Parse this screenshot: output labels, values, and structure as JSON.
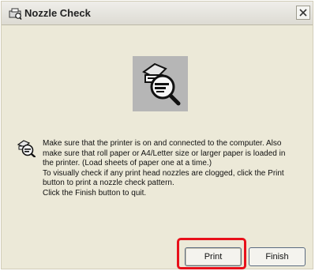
{
  "window": {
    "title": "Nozzle Check",
    "title_icon": "printer-check-icon",
    "close_icon": "close-icon"
  },
  "hero": {
    "icon": "nozzle-check-magnifier-icon"
  },
  "message": {
    "icon": "nozzle-check-icon",
    "lines": [
      "Make sure that the printer is on and connected to the computer. Also",
      "make sure that roll paper or A4/Letter size or larger paper is loaded in",
      "the printer. (Load sheets of paper one at a time.)",
      "To visually check if any print head nozzles are clogged, click the Print",
      "button to print a nozzle check pattern.",
      "Click the Finish button to quit."
    ]
  },
  "buttons": {
    "print_label": "Print",
    "finish_label": "Finish"
  },
  "colors": {
    "highlight": "#e8101a",
    "dialog_bg": "#ece9d8"
  }
}
